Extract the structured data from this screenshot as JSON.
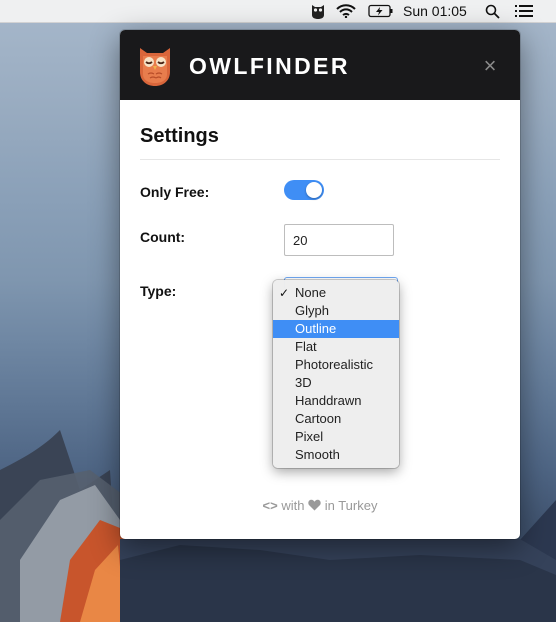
{
  "menubar": {
    "clock": "Sun 01:05",
    "icons": [
      "owl-extension-icon",
      "wifi-icon",
      "battery-charging-icon",
      "search-icon",
      "list-icon"
    ]
  },
  "app": {
    "name": "OWLFINDER",
    "close_glyph": "×"
  },
  "settings": {
    "title": "Settings",
    "only_free_label": "Only Free:",
    "only_free_on": true,
    "count_label": "Count:",
    "count_value": "20",
    "type_label": "Type:",
    "type_options": [
      "None",
      "Glyph",
      "Outline",
      "Flat",
      "Photorealistic",
      "3D",
      "Handdrawn",
      "Cartoon",
      "Pixel",
      "Smooth"
    ],
    "type_checked": "None",
    "type_highlighted": "Outline"
  },
  "footer": {
    "code_glyph": "<>",
    "with": "with",
    "heart_icon": "heart-icon",
    "in_text": "in Turkey"
  },
  "colors": {
    "accent": "#3f8ef5",
    "header_bg": "#19191b",
    "owl_orange": "#d9663b"
  }
}
